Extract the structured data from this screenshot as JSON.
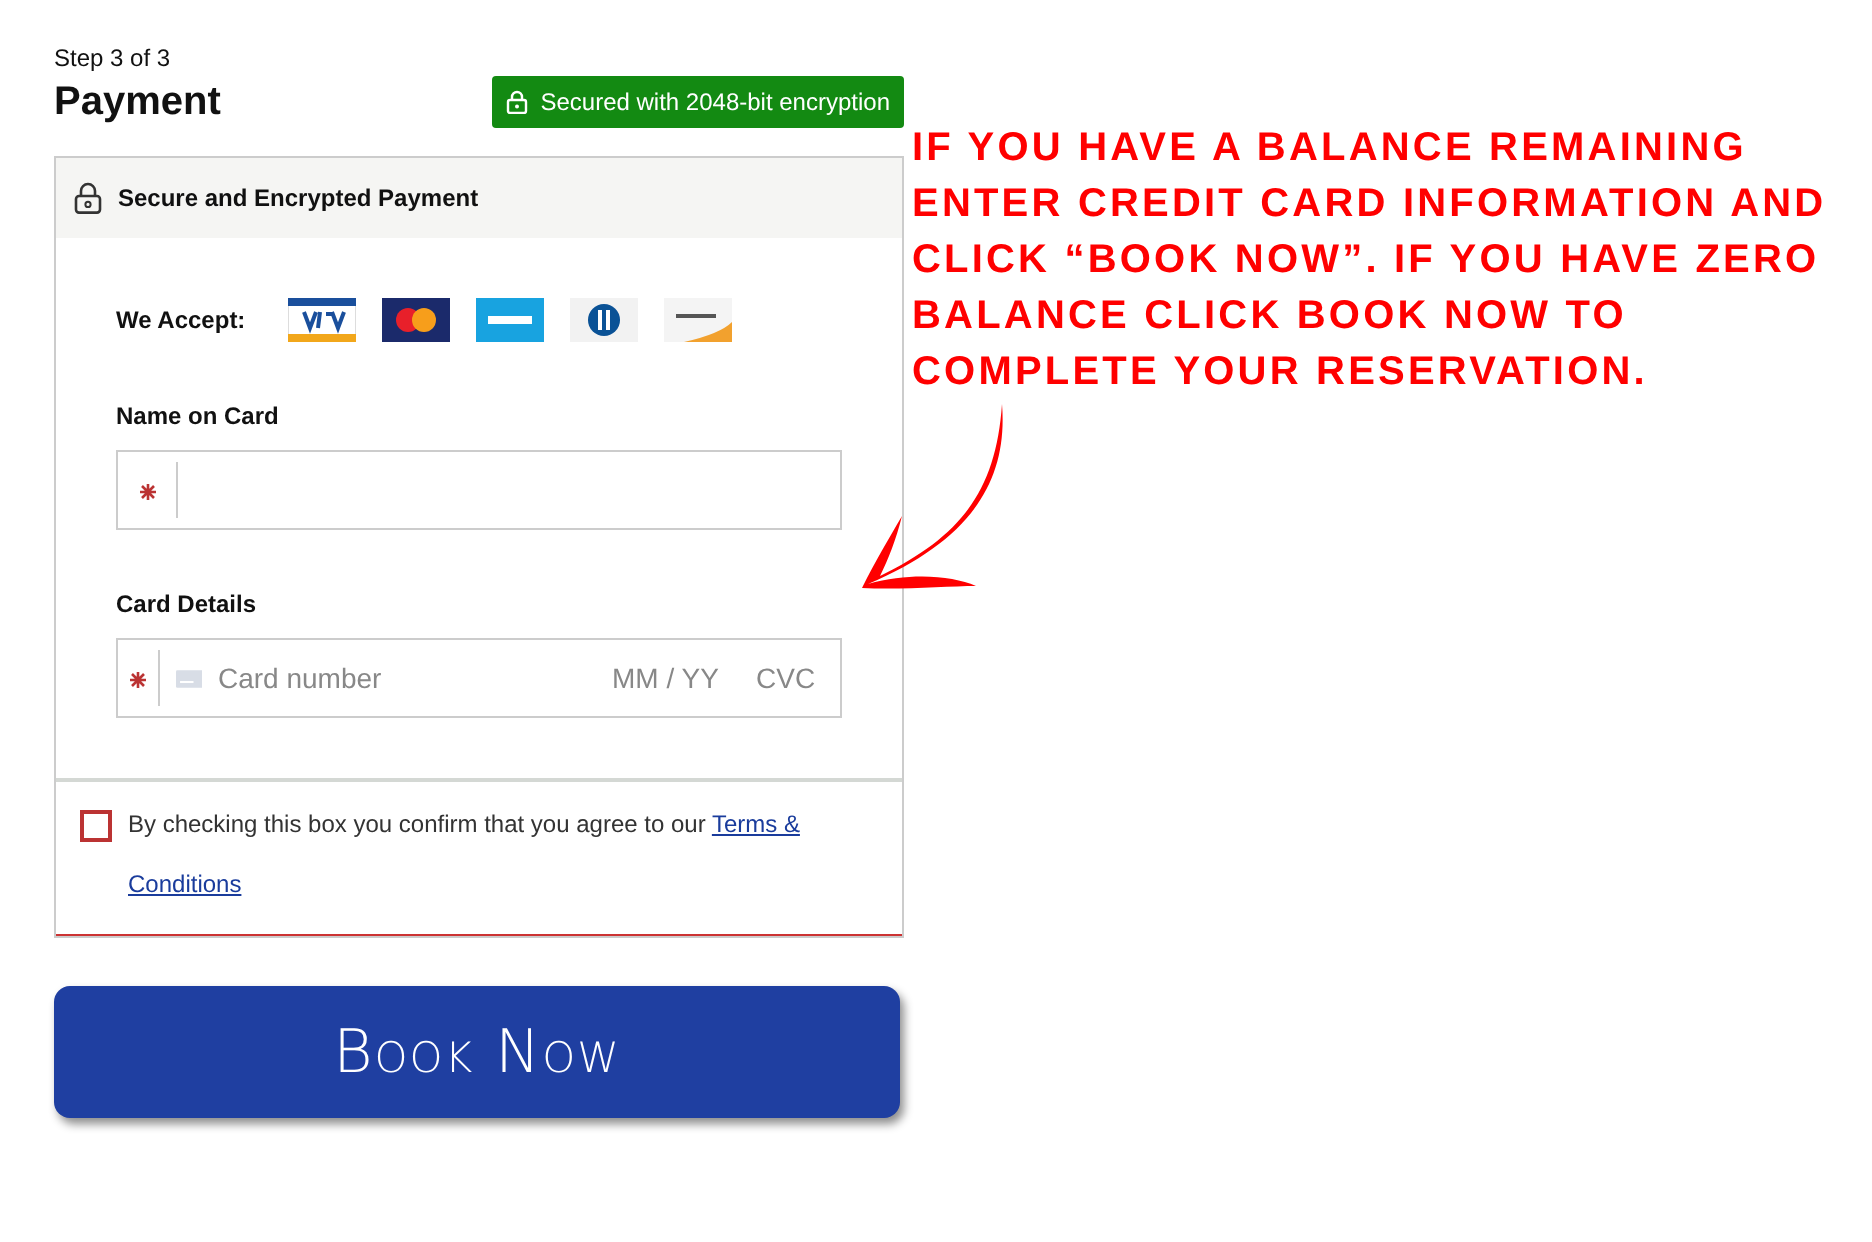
{
  "step": "Step 3 of 3",
  "title": "Payment",
  "secure_badge": "Secured with 2048-bit encryption",
  "panel": {
    "header": "Secure and Encrypted Payment",
    "accept_label": "We Accept:",
    "card_logos": [
      {
        "kind": "visa"
      },
      {
        "kind": "mastercard"
      },
      {
        "kind": "amex"
      },
      {
        "kind": "diners"
      },
      {
        "kind": "discover"
      }
    ],
    "fields": [
      {
        "label": "Name on Card",
        "kind": "text",
        "required": true
      },
      {
        "label": "Card Details",
        "kind": "card",
        "required": true,
        "placeholder": "Card number",
        "expiry_placeholder": "MM / YY",
        "cvc_placeholder": "CVC"
      }
    ]
  },
  "terms": {
    "checked": false,
    "text": "By checking this box you confirm that you agree to our",
    "link_lines": [
      "Terms &",
      "Conditions"
    ]
  },
  "book_button": "Book Now",
  "annotation": {
    "lines": [
      "IF YOU HAVE A BALANCE REMAINING",
      "ENTER CREDIT CARD INFORMATION AND",
      "CLICK “BOOK NOW”. IF YOU HAVE ZERO",
      "BALANCE CLICK BOOK NOW TO",
      "COMPLETE YOUR RESERVATION."
    ]
  }
}
